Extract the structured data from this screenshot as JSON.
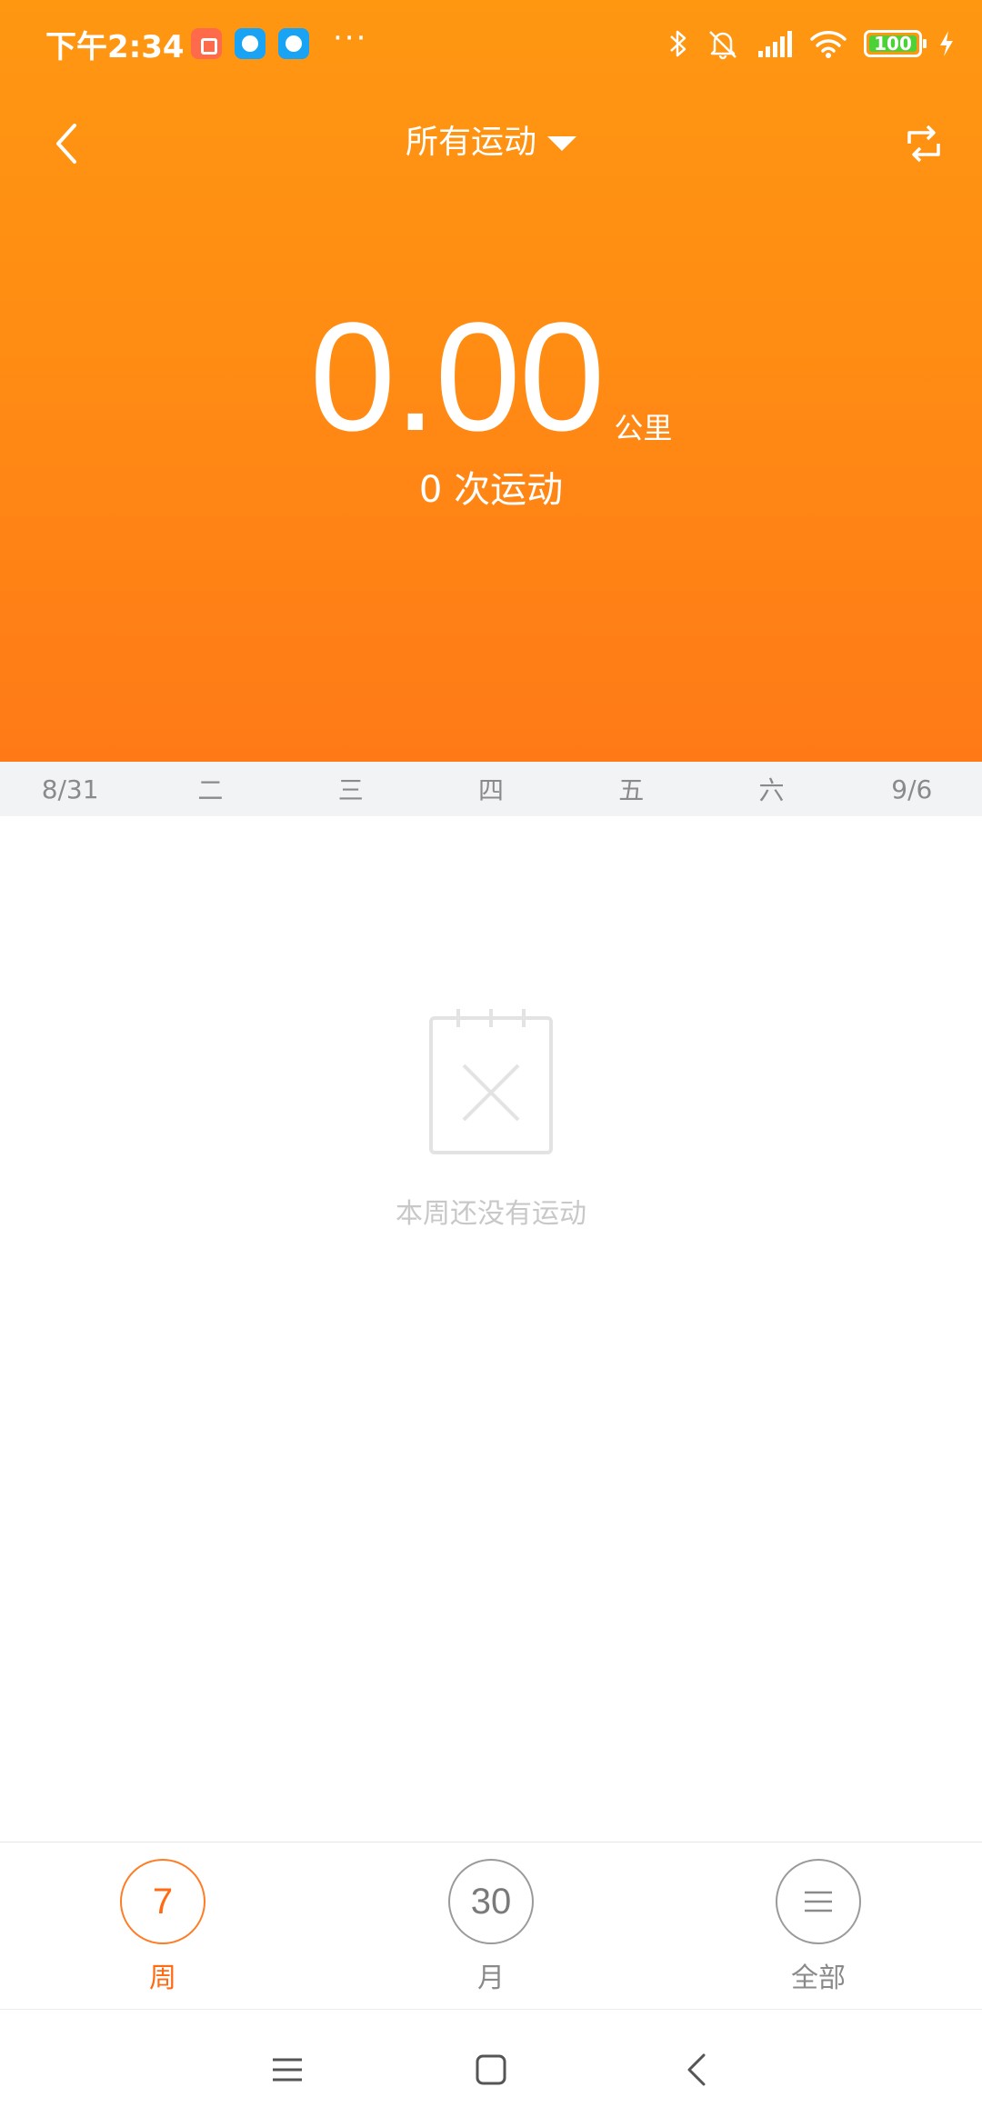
{
  "status_bar": {
    "time": "下午2:34",
    "more": "···",
    "battery": "100",
    "icons": [
      "app-notification-icon",
      "chat-icon",
      "chat-icon",
      "bluetooth-icon",
      "mute-icon",
      "signal-icon",
      "wifi-icon",
      "battery-icon",
      "charging-icon"
    ]
  },
  "header": {
    "title": "所有运动",
    "back_icon": "chevron-left-icon",
    "switch_icon": "repeat-icon"
  },
  "summary": {
    "distance": "0.00",
    "unit": "公里",
    "activity_count": "0 次运动"
  },
  "week": [
    "8/31",
    "二",
    "三",
    "四",
    "五",
    "六",
    "9/6"
  ],
  "empty_state": {
    "icon": "empty-calendar-icon",
    "text": "本周还没有运动"
  },
  "tabs": [
    {
      "badge": "7",
      "label": "周",
      "active": true
    },
    {
      "badge": "30",
      "label": "月",
      "active": false
    },
    {
      "badge": "☰",
      "label": "全部",
      "active": false
    }
  ],
  "colors": {
    "accent": "#ff7a17",
    "header_top": "#ff9711",
    "header_bottom": "#ff7a17",
    "active_tab": "#ff6a13"
  }
}
